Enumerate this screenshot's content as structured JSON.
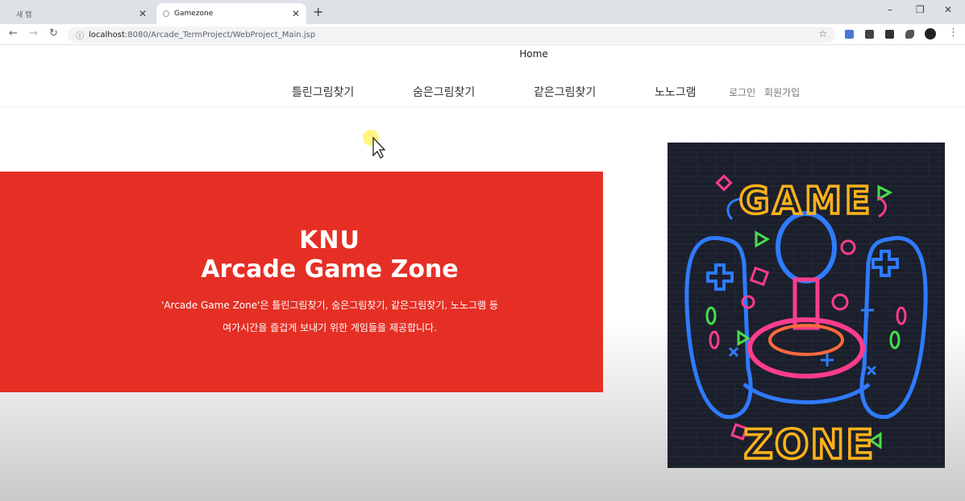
{
  "browser": {
    "tabs": [
      {
        "title": "새 탭",
        "active": false
      },
      {
        "title": "Gamezone",
        "active": true
      }
    ],
    "new_tab_icon": "plus-icon",
    "address": {
      "host": "localhost",
      "path": ":8080/Arcade_TermProject/WebProject_Main.jsp"
    },
    "window_controls": [
      "minimize-icon",
      "maximize-icon",
      "close-icon"
    ]
  },
  "page": {
    "home_label": "Home",
    "nav": [
      "틀린그림찾기",
      "숨은그림찾기",
      "같은그림찾기",
      "노노그램"
    ],
    "auth": {
      "login": "로그인",
      "signup": "회원가입"
    },
    "hero": {
      "logo": "KNU",
      "title": "Arcade Game Zone",
      "desc_line1": "'Arcade Game Zone'은 틀린그림찾기, 숨은그림찾기, 같은그림찾기, 노노그램 등",
      "desc_line2": "여가시간을 즐겁게 보내기 위한 게임들을 제공합니다."
    },
    "poster": {
      "word_top": "GAME",
      "word_bottom": "ZONE"
    }
  },
  "colors": {
    "hero_bg": "#e52f25",
    "poster_bg": "#1b1f2b",
    "neon_yellow": "#ffb21a",
    "neon_blue": "#2f7bff",
    "neon_pink": "#ff3c8e"
  }
}
